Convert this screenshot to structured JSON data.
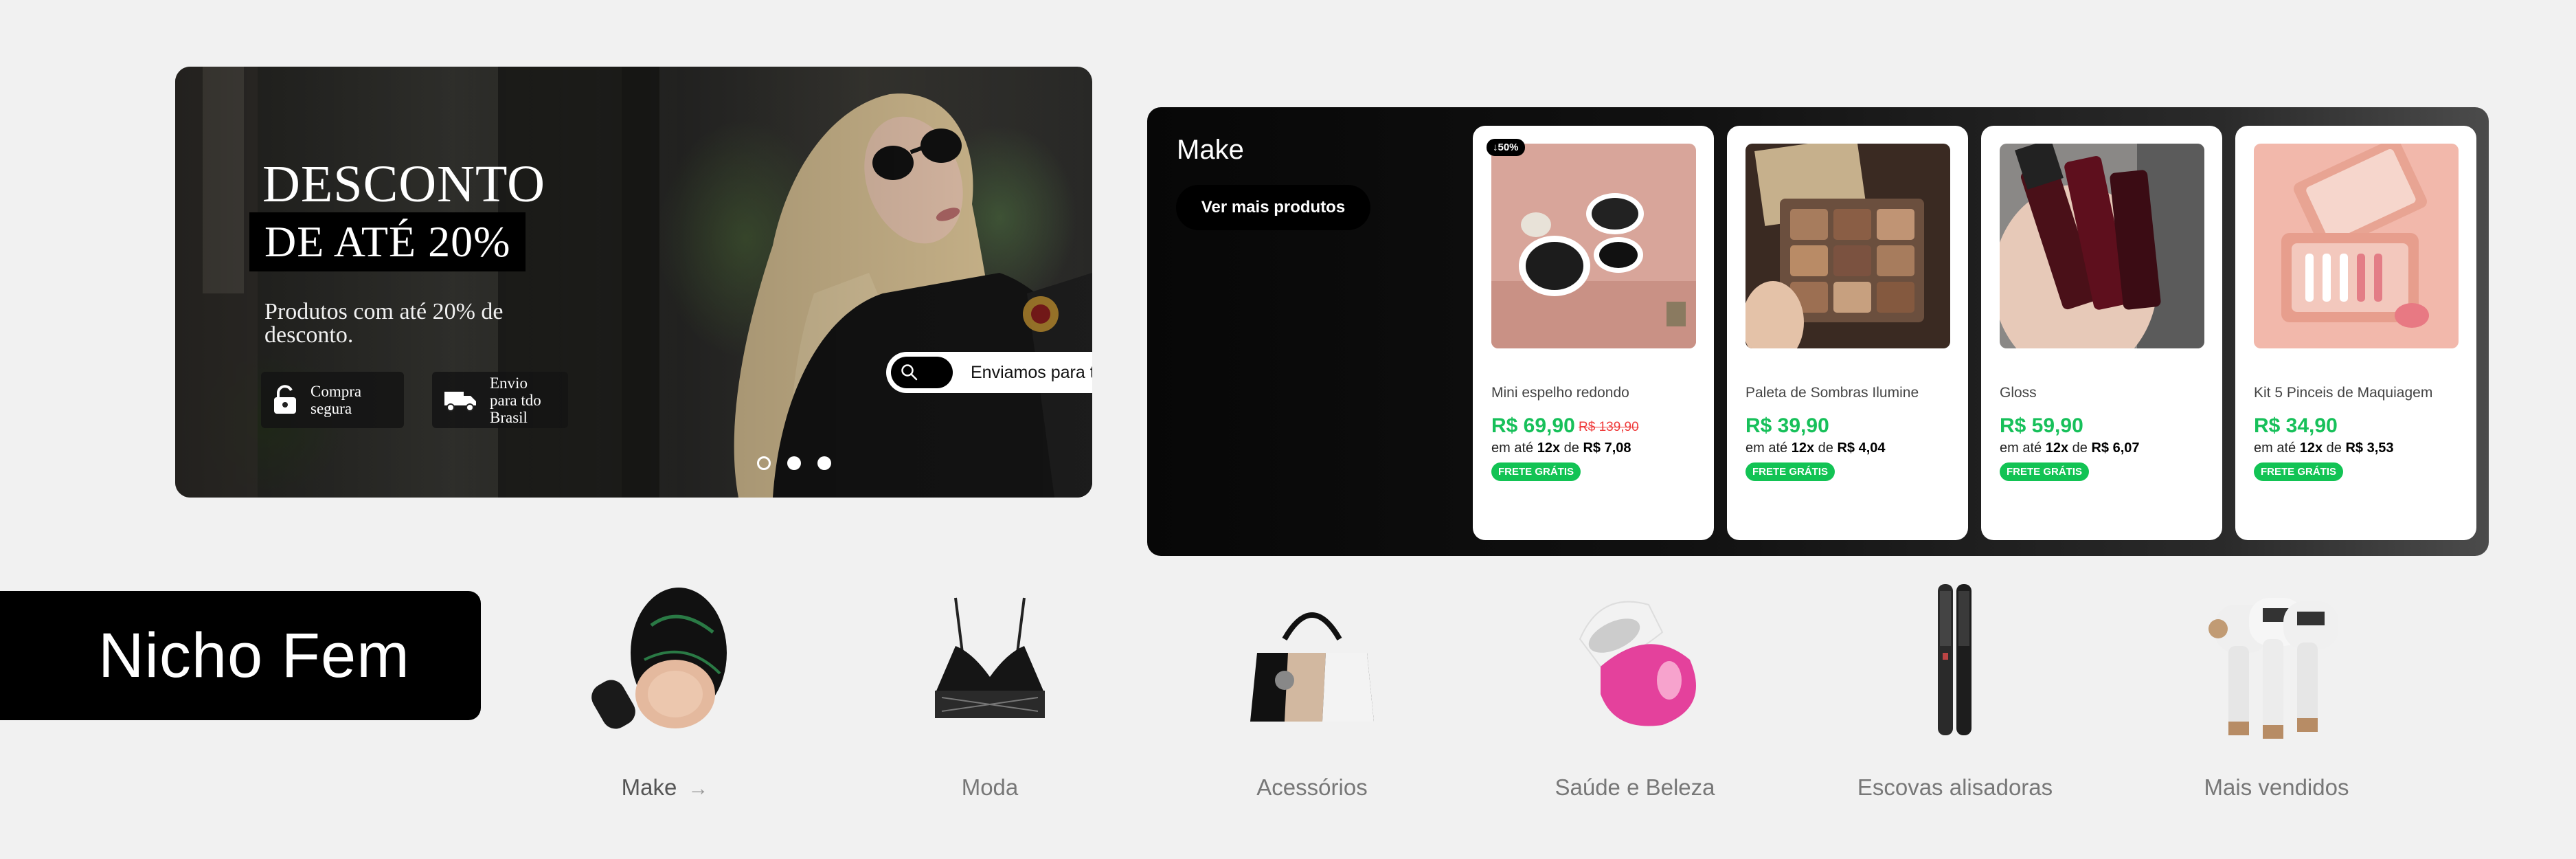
{
  "hero": {
    "title_line1": "DESCONTO",
    "title_line2": "DE ATÉ 20%",
    "subtitle": "Produtos com até 20% de desconto.",
    "badge_secure": "Compra segura",
    "badge_shipping": "Envio para tdo Brasil",
    "shipping_pill": "Enviamos para t",
    "slide_count": 3,
    "active_slide": 1
  },
  "make_panel": {
    "title": "Make",
    "see_more": "Ver mais produtos",
    "products": [
      {
        "name": "Mini espelho redondo",
        "price": "R$ 69,90",
        "old_price": "R$ 139,90",
        "discount": "↓50%",
        "installment_prefix": "em até",
        "installment_count": "12x",
        "installment_mid": "de",
        "installment_value": "R$ 7,08",
        "badge": "FRETE GRÁTIS"
      },
      {
        "name": "Paleta de Sombras Ilumine",
        "price": "R$ 39,90",
        "old_price": "",
        "discount": "",
        "installment_prefix": "em até",
        "installment_count": "12x",
        "installment_mid": "de",
        "installment_value": "R$ 4,04",
        "badge": "FRETE GRÁTIS"
      },
      {
        "name": "Gloss",
        "price": "R$ 59,90",
        "old_price": "",
        "discount": "",
        "installment_prefix": "em até",
        "installment_count": "12x",
        "installment_mid": "de",
        "installment_value": "R$ 6,07",
        "badge": "FRETE GRÁTIS"
      },
      {
        "name": "Kit 5 Pinceis de Maquiagem",
        "price": "R$ 34,90",
        "old_price": "",
        "discount": "",
        "installment_prefix": "em até",
        "installment_count": "12x",
        "installment_mid": "de",
        "installment_value": "R$ 3,53",
        "badge": "FRETE GRÁTIS"
      }
    ]
  },
  "section_title": "Nicho Fem",
  "categories": [
    {
      "label": "Make",
      "icon": "cushion-foundation-image",
      "active": true
    },
    {
      "label": "Moda",
      "icon": "bra-image"
    },
    {
      "label": "Acessórios",
      "icon": "handbag-image"
    },
    {
      "label": "Saúde e Beleza",
      "icon": "epilator-image"
    },
    {
      "label": "Escovas alisadoras",
      "icon": "straightening-brush-image"
    },
    {
      "label": "Mais vendidos",
      "icon": "ipl-device-image"
    }
  ],
  "colors": {
    "price_green": "#17c05a",
    "old_price_red": "#ef3b3b",
    "free_badge": "#12c354",
    "dark": "#000000",
    "page_bg": "#f1f1f1"
  }
}
